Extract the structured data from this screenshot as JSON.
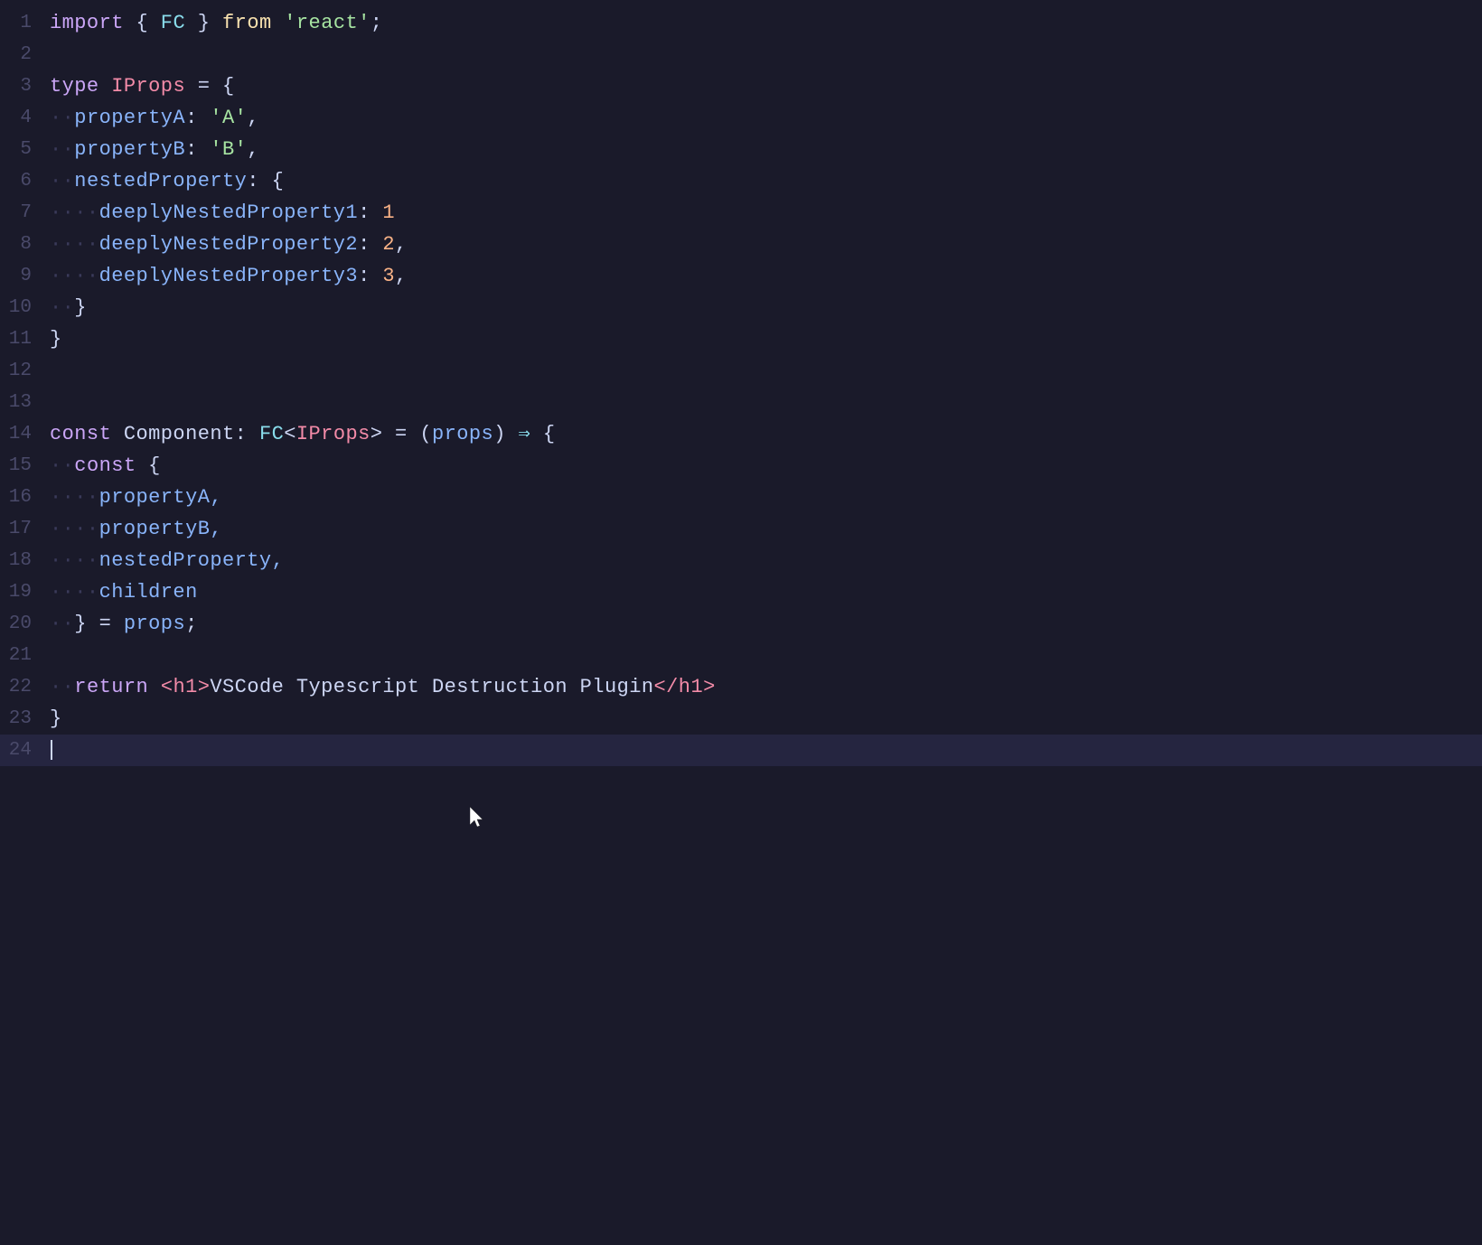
{
  "editor": {
    "background": "#1a1a2a",
    "lines": [
      {
        "num": 1,
        "tokens": [
          {
            "text": "import",
            "cls": "kw-import"
          },
          {
            "text": " { ",
            "cls": "punct"
          },
          {
            "text": "FC",
            "cls": "fc-name"
          },
          {
            "text": " } ",
            "cls": "punct"
          },
          {
            "text": "from",
            "cls": "from-kw"
          },
          {
            "text": " ",
            "cls": "punct"
          },
          {
            "text": "'react'",
            "cls": "string"
          },
          {
            "text": ";",
            "cls": "punct"
          }
        ],
        "indent": ""
      },
      {
        "num": 2,
        "tokens": [],
        "indent": ""
      },
      {
        "num": 3,
        "tokens": [
          {
            "text": "type",
            "cls": "kw-type"
          },
          {
            "text": " ",
            "cls": "punct"
          },
          {
            "text": "IProps",
            "cls": "type-name"
          },
          {
            "text": " = {",
            "cls": "punct"
          }
        ],
        "indent": ""
      },
      {
        "num": 4,
        "tokens": [
          {
            "text": "··",
            "cls": "indent-dots"
          },
          {
            "text": "propertyA",
            "cls": "prop-name"
          },
          {
            "text": ": ",
            "cls": "punct"
          },
          {
            "text": "'A'",
            "cls": "string"
          },
          {
            "text": ",",
            "cls": "punct"
          }
        ],
        "indent": ""
      },
      {
        "num": 5,
        "tokens": [
          {
            "text": "··",
            "cls": "indent-dots"
          },
          {
            "text": "propertyB",
            "cls": "prop-name"
          },
          {
            "text": ": ",
            "cls": "punct"
          },
          {
            "text": "'B'",
            "cls": "string"
          },
          {
            "text": ",",
            "cls": "punct"
          }
        ],
        "indent": ""
      },
      {
        "num": 6,
        "tokens": [
          {
            "text": "··",
            "cls": "indent-dots"
          },
          {
            "text": "nestedProperty",
            "cls": "prop-name"
          },
          {
            "text": ": {",
            "cls": "punct"
          }
        ],
        "indent": ""
      },
      {
        "num": 7,
        "tokens": [
          {
            "text": "····",
            "cls": "indent-dots"
          },
          {
            "text": "deeplyNestedProperty1",
            "cls": "prop-name"
          },
          {
            "text": ": ",
            "cls": "punct"
          },
          {
            "text": "1",
            "cls": "number"
          }
        ],
        "indent": ""
      },
      {
        "num": 8,
        "tokens": [
          {
            "text": "····",
            "cls": "indent-dots"
          },
          {
            "text": "deeplyNestedProperty2",
            "cls": "prop-name"
          },
          {
            "text": ": ",
            "cls": "punct"
          },
          {
            "text": "2",
            "cls": "number"
          },
          {
            "text": ",",
            "cls": "punct"
          }
        ],
        "indent": ""
      },
      {
        "num": 9,
        "tokens": [
          {
            "text": "····",
            "cls": "indent-dots"
          },
          {
            "text": "deeplyNestedProperty3",
            "cls": "prop-name"
          },
          {
            "text": ": ",
            "cls": "punct"
          },
          {
            "text": "3",
            "cls": "number"
          },
          {
            "text": ",",
            "cls": "punct"
          }
        ],
        "indent": ""
      },
      {
        "num": 10,
        "tokens": [
          {
            "text": "··",
            "cls": "indent-dots"
          },
          {
            "text": "}",
            "cls": "punct"
          }
        ],
        "indent": ""
      },
      {
        "num": 11,
        "tokens": [
          {
            "text": "}",
            "cls": "punct"
          }
        ],
        "indent": ""
      },
      {
        "num": 12,
        "tokens": [],
        "indent": ""
      },
      {
        "num": 13,
        "tokens": [],
        "indent": ""
      },
      {
        "num": 14,
        "tokens": [
          {
            "text": "const",
            "cls": "kw-const"
          },
          {
            "text": " Component: ",
            "cls": "punct"
          },
          {
            "text": "FC",
            "cls": "fc-name"
          },
          {
            "text": "<",
            "cls": "punct"
          },
          {
            "text": "IProps",
            "cls": "type-name"
          },
          {
            "text": "> = (",
            "cls": "punct"
          },
          {
            "text": "props",
            "cls": "prop-name"
          },
          {
            "text": ") ",
            "cls": "punct"
          },
          {
            "text": "⇒",
            "cls": "arrow"
          },
          {
            "text": " {",
            "cls": "punct"
          }
        ],
        "indent": ""
      },
      {
        "num": 15,
        "tokens": [
          {
            "text": "··",
            "cls": "indent-dots"
          },
          {
            "text": "const",
            "cls": "kw-const"
          },
          {
            "text": " {",
            "cls": "punct"
          }
        ],
        "indent": ""
      },
      {
        "num": 16,
        "tokens": [
          {
            "text": "····",
            "cls": "indent-dots"
          },
          {
            "text": "propertyA,",
            "cls": "prop-name"
          }
        ],
        "indent": ""
      },
      {
        "num": 17,
        "tokens": [
          {
            "text": "····",
            "cls": "indent-dots"
          },
          {
            "text": "propertyB,",
            "cls": "prop-name"
          }
        ],
        "indent": ""
      },
      {
        "num": 18,
        "tokens": [
          {
            "text": "····",
            "cls": "indent-dots"
          },
          {
            "text": "nestedProperty,",
            "cls": "prop-name"
          }
        ],
        "indent": ""
      },
      {
        "num": 19,
        "tokens": [
          {
            "text": "····",
            "cls": "indent-dots"
          },
          {
            "text": "children",
            "cls": "prop-name"
          }
        ],
        "indent": ""
      },
      {
        "num": 20,
        "tokens": [
          {
            "text": "··",
            "cls": "indent-dots"
          },
          {
            "text": "} = ",
            "cls": "punct"
          },
          {
            "text": "props",
            "cls": "prop-name"
          },
          {
            "text": ";",
            "cls": "punct"
          }
        ],
        "indent": ""
      },
      {
        "num": 21,
        "tokens": [],
        "indent": ""
      },
      {
        "num": 22,
        "tokens": [
          {
            "text": "··",
            "cls": "indent-dots"
          },
          {
            "text": "return",
            "cls": "kw-return"
          },
          {
            "text": " ",
            "cls": "punct"
          },
          {
            "text": "<h1>",
            "cls": "tag"
          },
          {
            "text": "VSCode Typescript Destruction Plugin",
            "cls": "tag-inner"
          },
          {
            "text": "</h1>",
            "cls": "tag"
          }
        ],
        "indent": ""
      },
      {
        "num": 23,
        "tokens": [
          {
            "text": "}",
            "cls": "punct"
          }
        ],
        "indent": ""
      },
      {
        "num": 24,
        "tokens": [],
        "indent": "",
        "isCursor": true
      }
    ]
  }
}
